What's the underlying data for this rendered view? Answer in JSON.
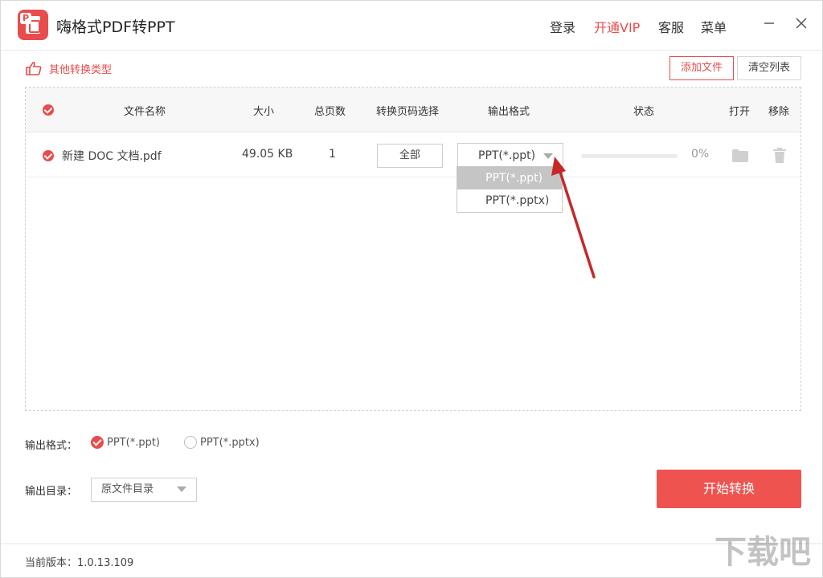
{
  "app": {
    "title": "嗨格式PDF转PPT",
    "brand_color": "#e84c4c"
  },
  "top_nav": {
    "login": "登录",
    "vip": "开通VIP",
    "service": "客服",
    "menu": "菜单"
  },
  "toolbar": {
    "other_types": "其他转换类型",
    "add_file": "添加文件",
    "clear_list": "清空列表"
  },
  "table": {
    "headers": {
      "name": "文件名称",
      "size": "大小",
      "pages": "总页数",
      "page_select": "转换页码选择",
      "format": "输出格式",
      "status": "状态",
      "open": "打开",
      "remove": "移除"
    },
    "rows": [
      {
        "name": "新建 DOC 文档.pdf",
        "size": "49.05 KB",
        "pages": "1",
        "page_select": "全部",
        "format": "PPT(*.ppt)",
        "progress_text": "0%",
        "progress": 0
      }
    ]
  },
  "format_dropdown": {
    "options": [
      "PPT(*.ppt)",
      "PPT(*.pptx)"
    ],
    "selected": "PPT(*.ppt)"
  },
  "output_format": {
    "label": "输出格式：",
    "option_ppt": "PPT(*.ppt)",
    "option_pptx": "PPT(*.pptx)",
    "selected": "PPT(*.ppt)"
  },
  "output_dir": {
    "label": "输出目录：",
    "value": "原文件目录"
  },
  "start_button": "开始转换",
  "status_bar": {
    "version": "当前版本：1.0.13.109"
  },
  "watermark_text": "下载吧"
}
